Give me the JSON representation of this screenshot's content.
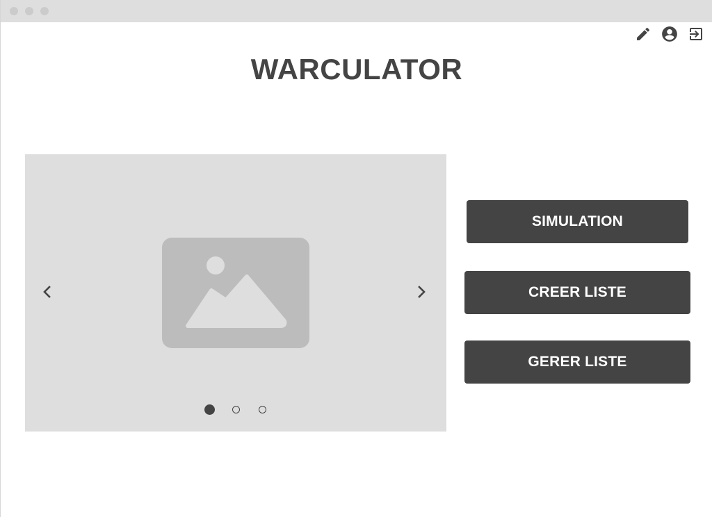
{
  "app": {
    "title": "WARCULATOR"
  },
  "toolbar": {
    "icons": [
      "pencil-icon",
      "user-account-icon",
      "logout-icon"
    ]
  },
  "carousel": {
    "image_icon": "image-placeholder-icon",
    "prev_icon": "chevron-left-icon",
    "next_icon": "chevron-right-icon",
    "slide_count": 3,
    "active_slide": 1
  },
  "actions": {
    "simulation_label": "SIMULATION",
    "creer_liste_label": "CREER LISTE",
    "gerer_liste_label": "GERER LISTE"
  },
  "colors": {
    "button_bg": "#444444",
    "button_text": "#ffffff",
    "title": "#444444",
    "carousel_bg": "#dedede",
    "placeholder_bg": "#bcbcbc",
    "titlebar_bg": "#dedede"
  }
}
